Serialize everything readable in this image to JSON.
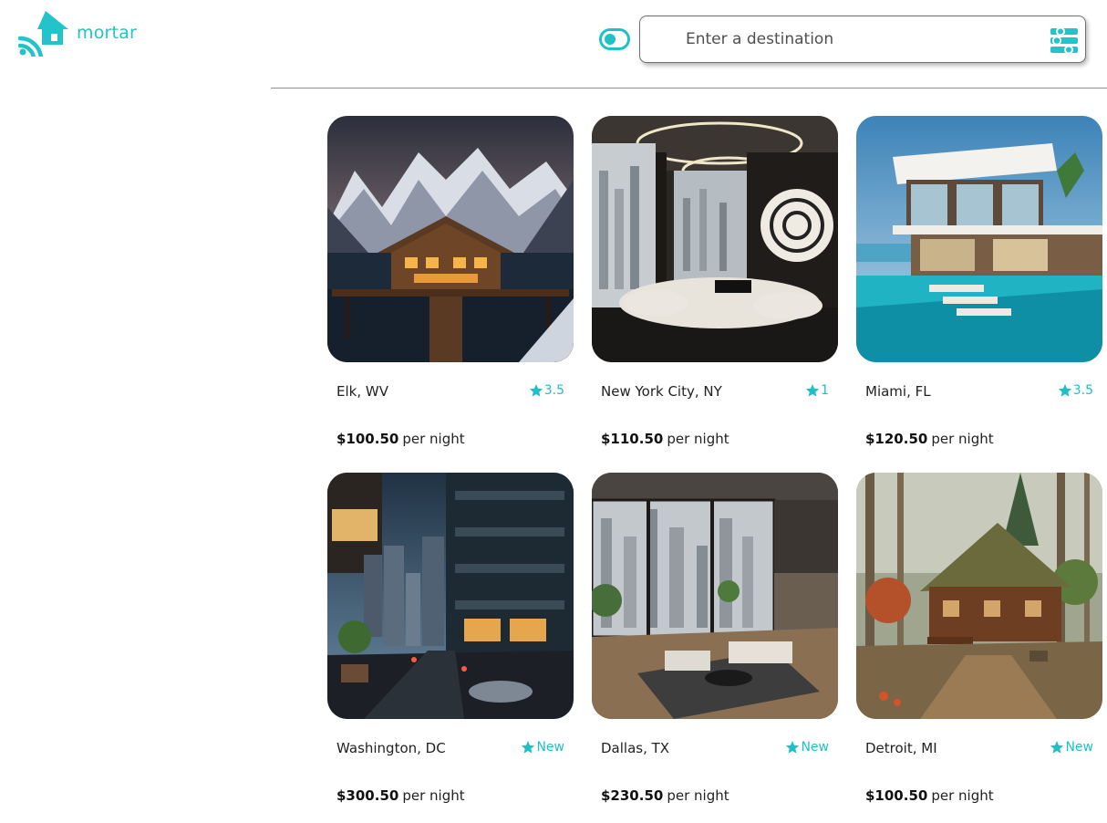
{
  "app": {
    "logo_text": "mortar"
  },
  "search": {
    "placeholder": "Enter a destination",
    "value": ""
  },
  "toggle": {
    "state": "off"
  },
  "colors": {
    "accent": "#22c3c9",
    "star": "#20bfc7",
    "divider": "#8f8f8f"
  },
  "icons": {
    "logo": "house-wifi-icon",
    "toggle": "toggle-switch-icon",
    "filter": "filter-sliders-icon",
    "rating": "star-icon"
  },
  "listings": [
    {
      "location": "Elk, WV",
      "rating": "3.5",
      "price": "$100.50",
      "price_unit": "per night",
      "image": "mountain-lake-chalet"
    },
    {
      "location": "New York City, NY",
      "rating": "1",
      "price": "$110.50",
      "price_unit": "per night",
      "image": "penthouse-interior"
    },
    {
      "location": "Miami, FL",
      "rating": "3.5",
      "price": "$120.50",
      "price_unit": "per night",
      "image": "modern-beach-villa"
    },
    {
      "location": "Washington, DC",
      "rating": "New",
      "price": "$300.50",
      "price_unit": "per night",
      "image": "city-street-night"
    },
    {
      "location": "Dallas, TX",
      "rating": "New",
      "price": "$230.50",
      "price_unit": "per night",
      "image": "loft-living-room"
    },
    {
      "location": "Detroit, MI",
      "rating": "New",
      "price": "$100.50",
      "price_unit": "per night",
      "image": "forest-cabin"
    }
  ]
}
